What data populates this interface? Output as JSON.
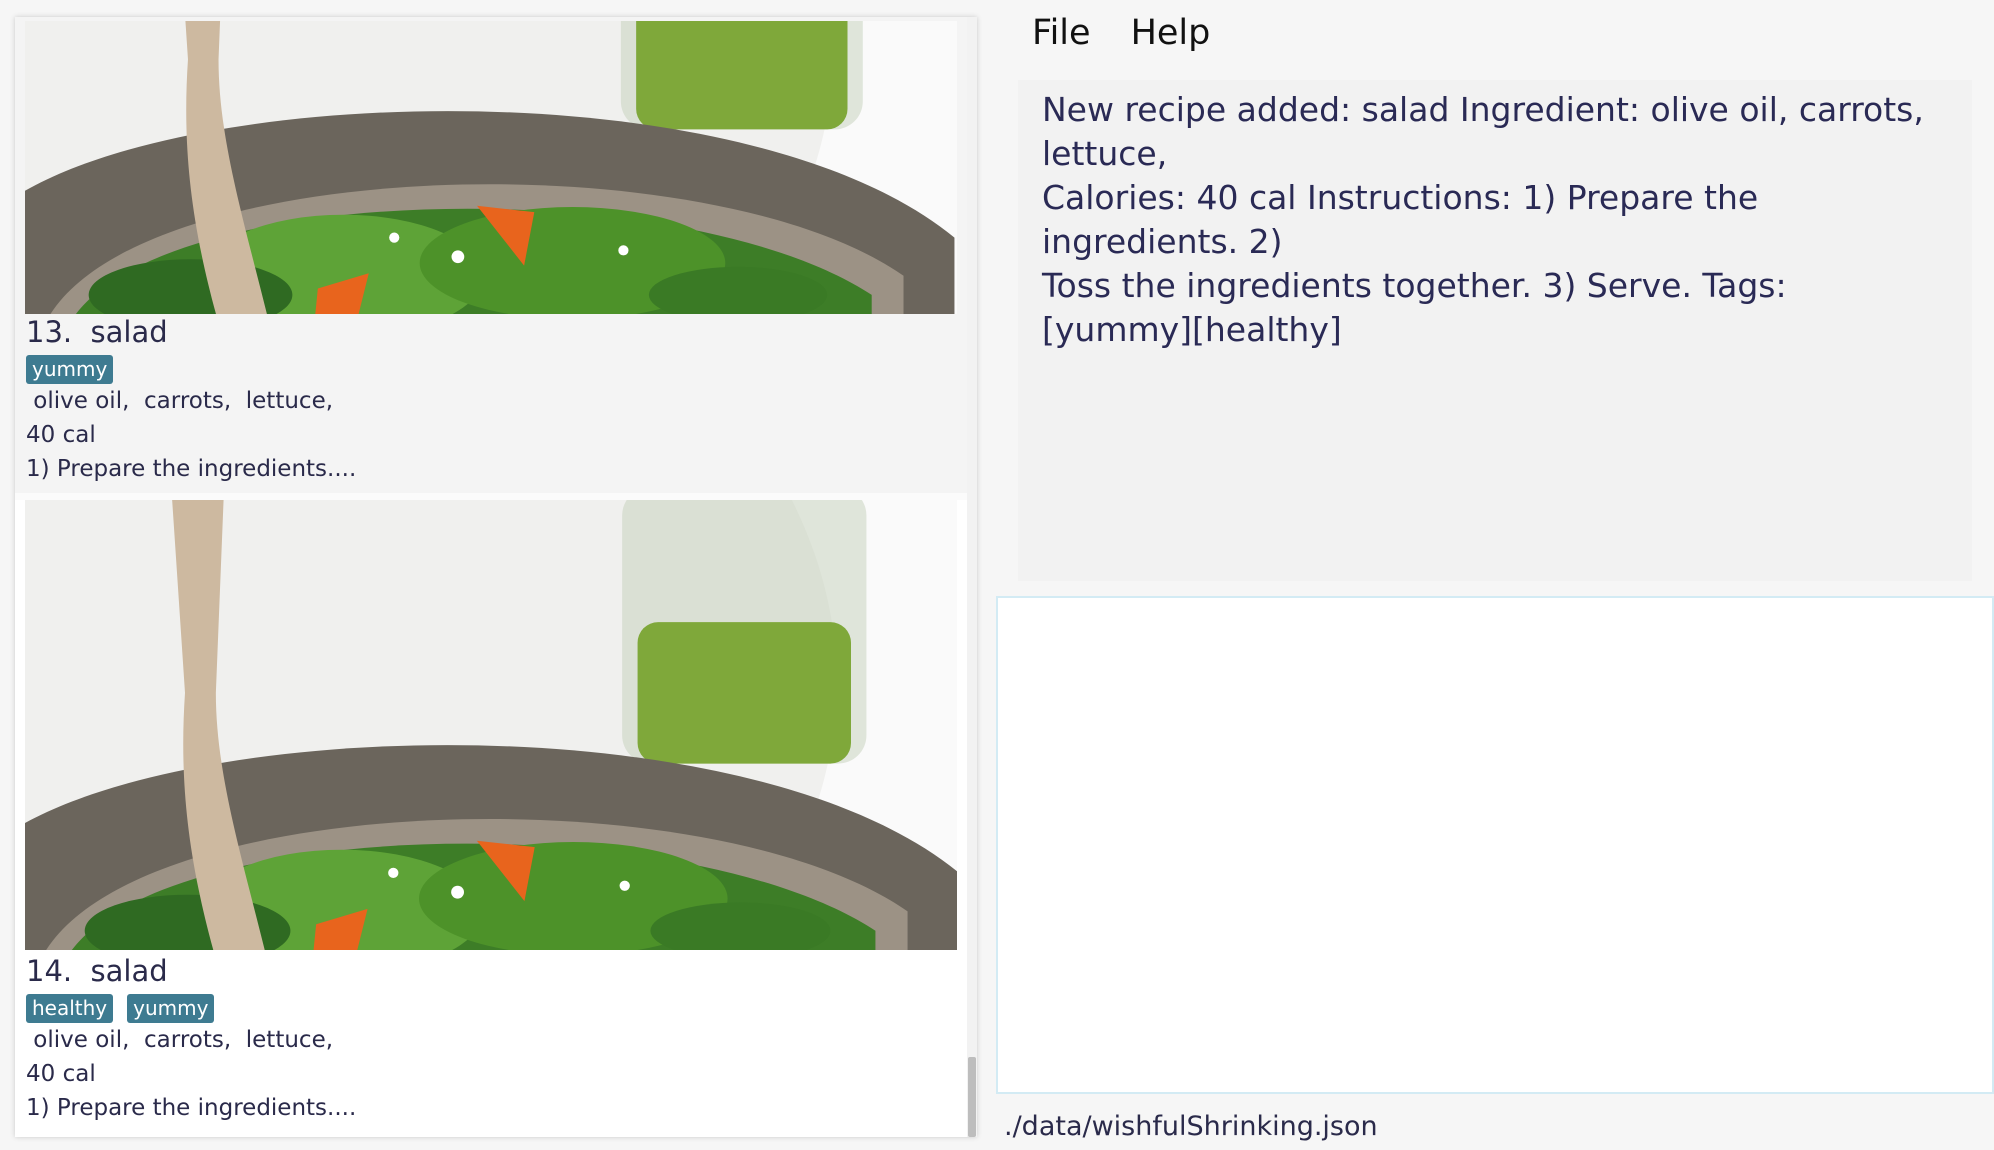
{
  "menu": {
    "file": "File",
    "help": "Help"
  },
  "recipes": [
    {
      "title": "13.  salad",
      "tags": [
        "yummy"
      ],
      "ingredients": " olive oil,  carrots,  lettuce,",
      "calories": "40 cal",
      "instructions": "1) Prepare the ingredients...."
    },
    {
      "title": "14.  salad",
      "tags": [
        "healthy",
        "yummy"
      ],
      "ingredients": " olive oil,  carrots,  lettuce,",
      "calories": "40 cal",
      "instructions": "1) Prepare the ingredients...."
    }
  ],
  "result": {
    "text": "New recipe added: salad Ingredient:  olive oil,  carrots,  lettuce,\nCalories: 40 cal Instructions: 1) Prepare the ingredients.  2)\nToss the ingredients together.  3) Serve. Tags:\n[yummy][healthy]"
  },
  "command": {
    "value": ""
  },
  "status": {
    "path": "./data/wishfulShrinking.json"
  },
  "colors": {
    "tag_background": "#3e7b91",
    "command_border": "#d3ebf4",
    "text": "#2a2a4a"
  },
  "icons": {
    "recipe_image": "salad-bowl-photo"
  }
}
